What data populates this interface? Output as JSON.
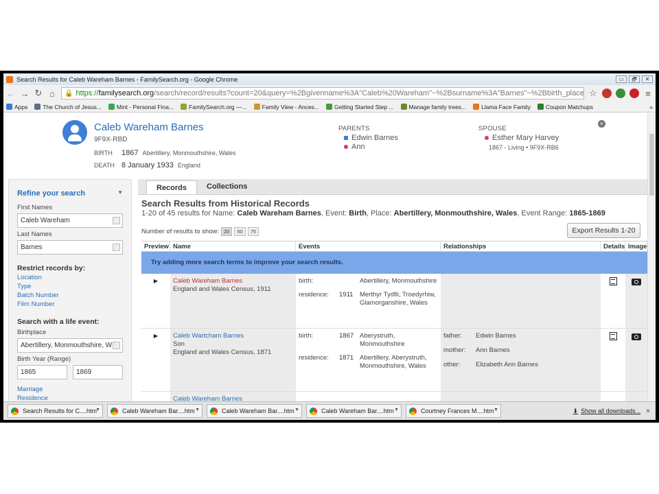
{
  "window": {
    "title": "Search Results for Caleb Wareham Barnes - FamilySearch.org - Google Chrome",
    "controls": [
      "▭",
      "🗗",
      "✕"
    ]
  },
  "browser": {
    "url_scheme": "https://",
    "url_host": "familysearch.org",
    "url_path": "/search/record/results?count=20&query=%2Bgivenname%3A\"Caleb%20Wareham\"~%2Bsurname%3A\"Barnes\"~%2Bbirth_place",
    "bookmarks": [
      {
        "label": "Apps",
        "color": "#3c78d8"
      },
      {
        "label": "The Church of Jesus...",
        "color": "#5b6f8a"
      },
      {
        "label": "Mint - Personal Fina...",
        "color": "#3aa757"
      },
      {
        "label": "FamilySearch.org —...",
        "color": "#8aa636"
      },
      {
        "label": "Family View - Ances...",
        "color": "#c99a2e"
      },
      {
        "label": "Getting Started Step ...",
        "color": "#4a9a3a"
      },
      {
        "label": "Manage family trees...",
        "color": "#6a8a2a"
      },
      {
        "label": "Llama Face Family",
        "color": "#e8741c"
      },
      {
        "label": "Coupon Matchups",
        "color": "#2f7d2f"
      }
    ],
    "more_bookmarks": "»"
  },
  "person": {
    "name": "Caleb Wareham Barnes",
    "id": "9F9X-RBD",
    "birth_label": "BIRTH",
    "birth_year": "1867",
    "birth_place": "Abertillery, Monmouthshire, Wales",
    "death_label": "DEATH",
    "death_date": "8 January 1933",
    "death_place": "England",
    "parents_label": "PARENTS",
    "father": "Edwin Barnes",
    "mother": "Ann",
    "spouse_label": "SPOUSE",
    "spouse": "Esther Mary Harvey",
    "spouse_sub": "1867 - Living • 9F9X-RB6",
    "close": "×"
  },
  "sidebar": {
    "title": "Refine your search",
    "caret": "▼",
    "first_names_label": "First Names",
    "first_names_value": "Caleb Wareham",
    "last_names_label": "Last Names",
    "last_names_value": "Barnes",
    "restrict_title": "Restrict records by:",
    "restrict_links": [
      "Location",
      "Type",
      "Batch Number",
      "Film Number"
    ],
    "life_event_title": "Search with a life event:",
    "birthplace_label": "Birthplace",
    "birthplace_value": "Abertillery, Monmouthshire, W",
    "birth_year_label": "Birth Year (Range)",
    "birth_year_from": "1865",
    "birth_year_to": "1869",
    "event_links": [
      "Marriage",
      "Residence"
    ]
  },
  "tabs": [
    "Records",
    "Collections"
  ],
  "results": {
    "title": "Search Results from Historical Records",
    "summary_prefix": "1-20 of 45 results for Name:",
    "summary_name": "Caleb Wareham Barnes",
    "summary_event_label": ", Event:",
    "summary_event": "Birth",
    "summary_place_label": ", Place:",
    "summary_place": "Abertillery, Monmouthshire, Wales",
    "summary_range_label": ", Event Range:",
    "summary_range": "1865-1869",
    "per_page_label": "Number of results to show:",
    "per_page_options": [
      "20",
      "50",
      "75"
    ],
    "export_label": "Export Results 1-20",
    "columns": [
      "Preview",
      "Name",
      "Events",
      "Relationships",
      "Details",
      "Image"
    ],
    "hint": "Try adding more search terms to improve your search results.",
    "rows": [
      {
        "name": "Caleb Wareham Barnes",
        "role": "",
        "collection": "England and Wales Census, 1911",
        "events": [
          {
            "type": "birth:",
            "year": "",
            "place": "Abertillery, Monmouthshire"
          },
          {
            "type": "residence:",
            "year": "1911",
            "place": "Merthyr Tydfil, Troedyrhiw, Glamorganshire, Wales"
          }
        ],
        "relationships": []
      },
      {
        "name": "Caleb Wartcham Barnes",
        "role": "Son",
        "collection": "England and Wales Census, 1871",
        "events": [
          {
            "type": "birth:",
            "year": "1867",
            "place": "Aberystruth, Monmouthshire"
          },
          {
            "type": "residence:",
            "year": "1871",
            "place": "Abertillery, Aberystruth, Monmouthshire, Wales"
          }
        ],
        "relationships": [
          {
            "type": "father:",
            "name": "Edwin Barnes"
          },
          {
            "type": "mother:",
            "name": "Ann Barnes"
          },
          {
            "type": "other:",
            "name": "Elizabeth Ann Barnes"
          }
        ]
      }
    ],
    "partial_row_name": "Caleb Wareham Barnes"
  },
  "taskbar": {
    "items": [
      "Search Results for C....htm",
      "Caleb Wareham Bar....htm",
      "Caleb Wareham Bar....htm",
      "Caleb Wareham Bar....htm",
      "Courtney Frances M....htm"
    ],
    "show_all": "Show all downloads...",
    "close": "×"
  }
}
